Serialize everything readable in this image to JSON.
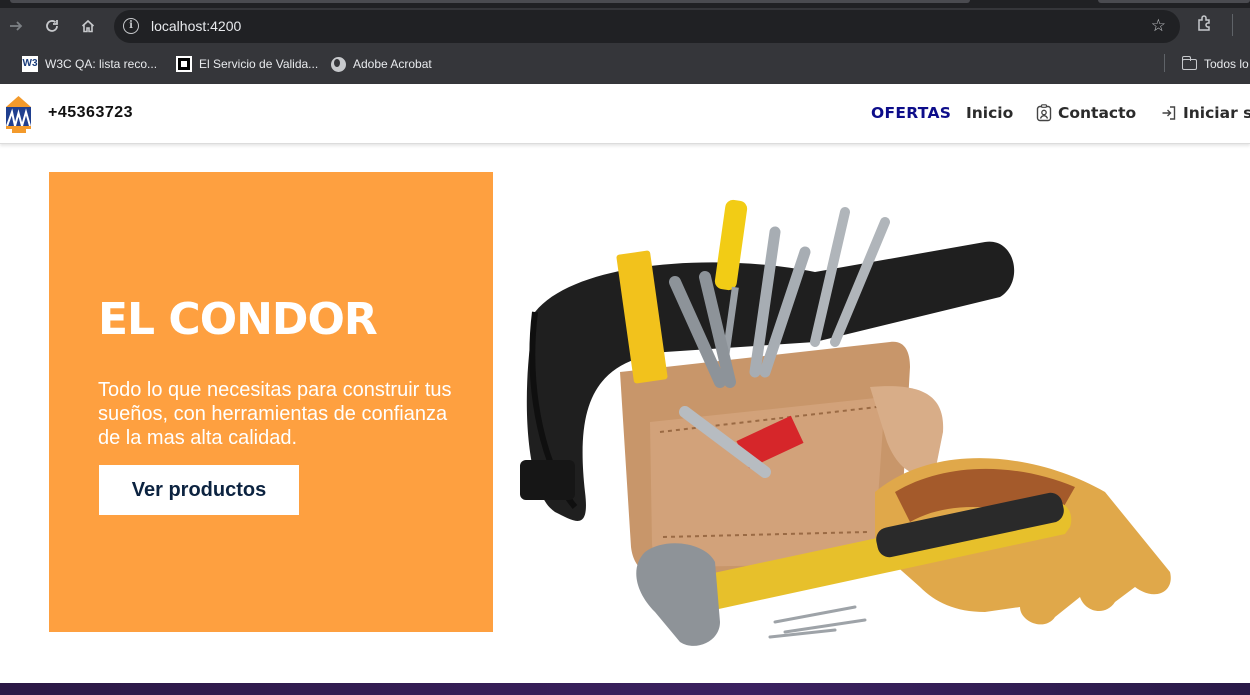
{
  "browser": {
    "url": "localhost:4200",
    "bookmarks": [
      {
        "label": "W3C QA: lista reco...",
        "icon": "w3c-icon"
      },
      {
        "label": "El Servicio de Valida...",
        "icon": "validator-icon"
      },
      {
        "label": "Adobe Acrobat",
        "icon": "globe-icon"
      }
    ],
    "bookmarks_folder": "Todos lo",
    "w3_glyph": "W3"
  },
  "header": {
    "phone": "+45363723",
    "nav": [
      {
        "label": "OFERTAS"
      },
      {
        "label": "Inicio"
      },
      {
        "label": "Contacto",
        "icon": "contact-badge-icon"
      },
      {
        "label": "Iniciar s",
        "icon": "login-icon"
      }
    ]
  },
  "hero": {
    "title": "EL CONDOR",
    "text": "Todo lo que necesitas para construir tus sueños, con herramientas de confianza de la mas alta calidad.",
    "button": "Ver productos"
  },
  "colors": {
    "hero_box": "#fea040",
    "ofertas": "#0d0d8a",
    "button_text": "#0c2340",
    "footer": "#3b2160"
  }
}
